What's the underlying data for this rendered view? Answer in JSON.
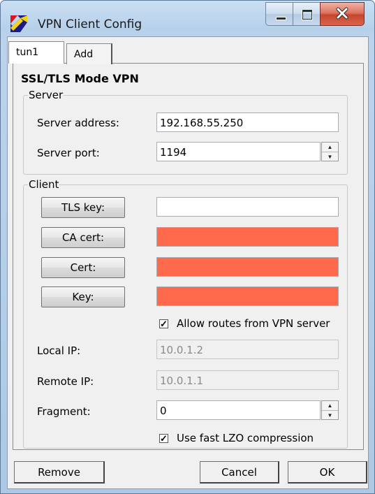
{
  "window": {
    "title": "VPN Client Config"
  },
  "tabs": [
    {
      "label": "tun1"
    },
    {
      "label": "Add"
    }
  ],
  "heading": "SSL/TLS Mode VPN",
  "server": {
    "legend": "Server",
    "address_label": "Server address:",
    "address_value": "192.168.55.250",
    "port_label": "Server port:",
    "port_value": "1194"
  },
  "client": {
    "legend": "Client",
    "tls_key_button": "TLS key:",
    "ca_cert_button": "CA cert:",
    "cert_button": "Cert:",
    "key_button": "Key:",
    "tls_key_value": "",
    "allow_routes_label": "Allow routes from VPN server",
    "allow_routes_checked": true,
    "local_ip_label": "Local IP:",
    "local_ip_value": "10.0.1.2",
    "remote_ip_label": "Remote IP:",
    "remote_ip_value": "10.0.1.1",
    "fragment_label": "Fragment:",
    "fragment_value": "0",
    "lzo_label": "Use fast LZO compression",
    "lzo_checked": true
  },
  "footer": {
    "remove": "Remove",
    "cancel": "Cancel",
    "ok": "OK"
  },
  "colors": {
    "missing_field": "#ff6a4c",
    "title_bar": "#c9dff3",
    "close_button": "#c6452d"
  },
  "icons": {
    "app": "app-logo-icon",
    "min": "minimize-icon",
    "max": "maximize-icon",
    "close": "close-icon",
    "check": "checkmark-icon",
    "spin_up": "spin-up-icon",
    "spin_down": "spin-down-icon"
  }
}
